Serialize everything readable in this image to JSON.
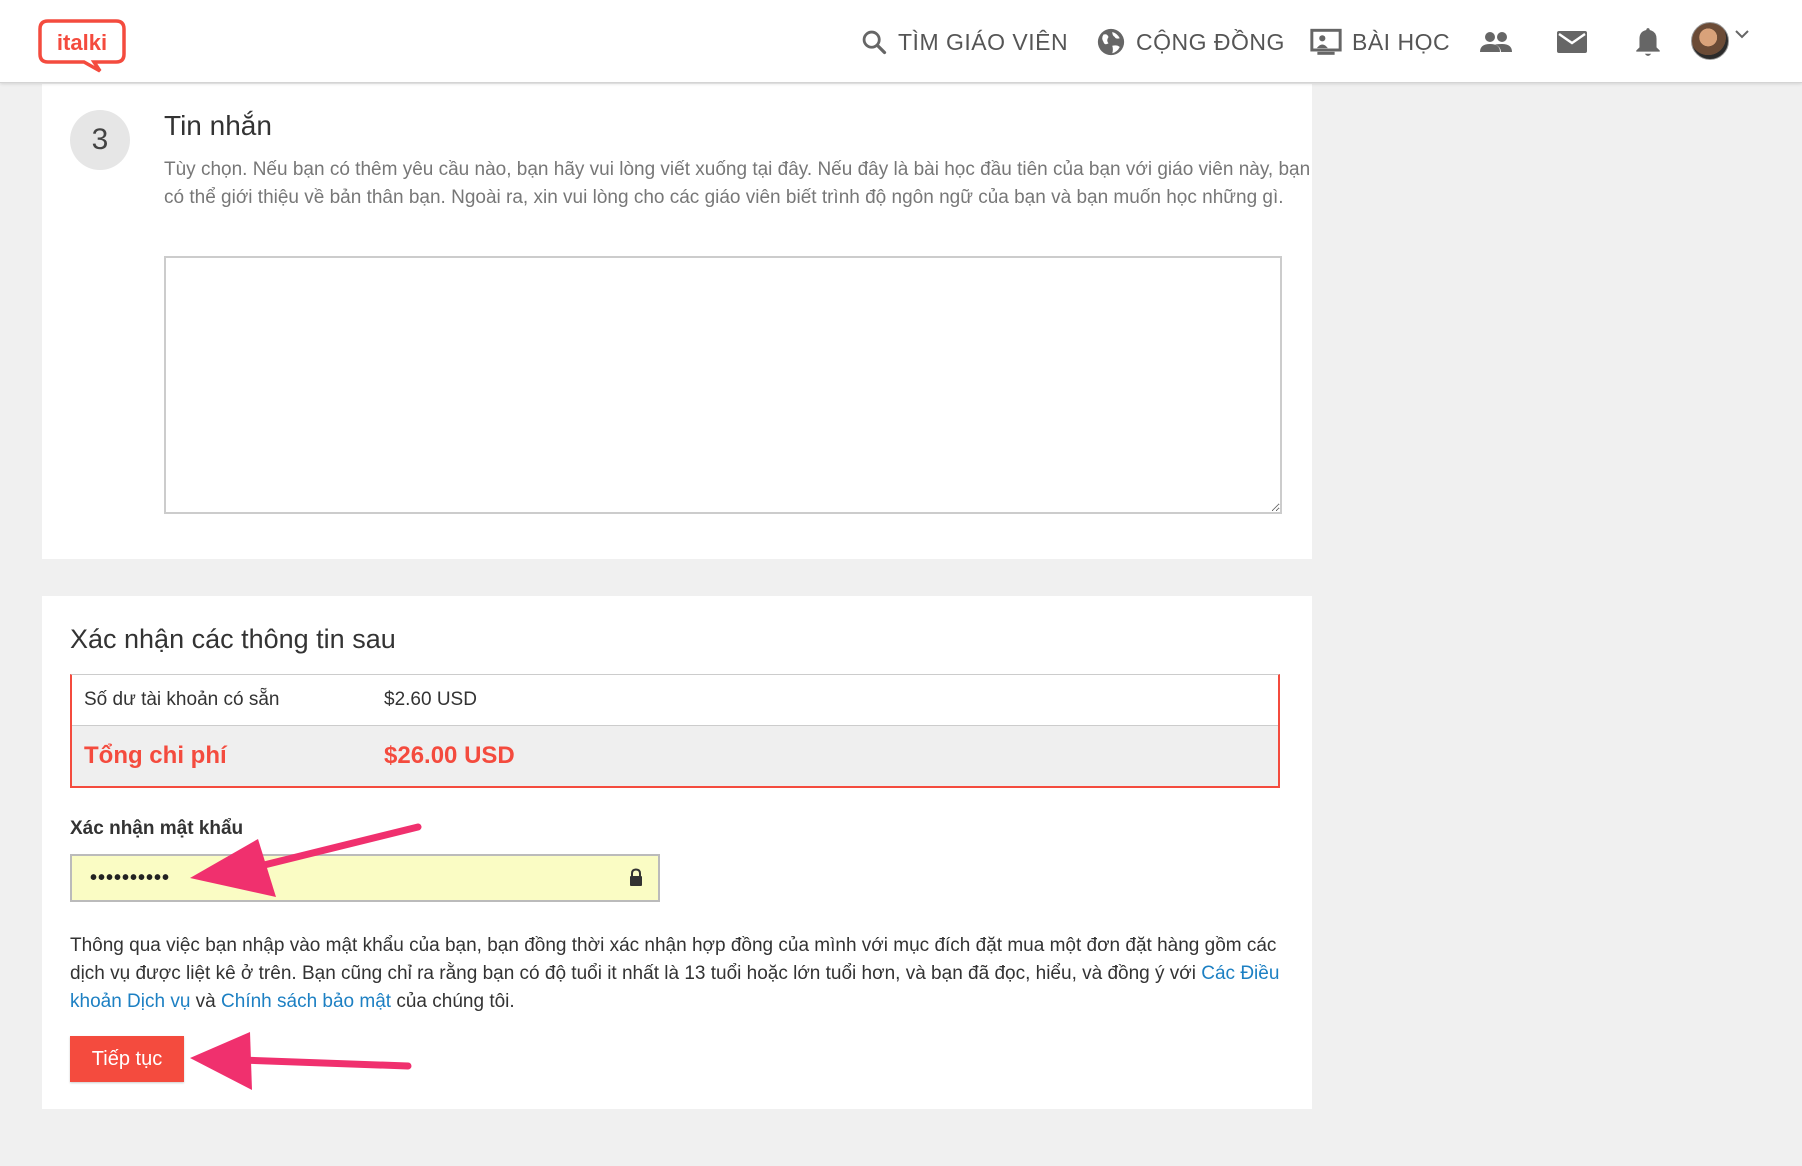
{
  "header": {
    "logo_text": "italki",
    "nav": {
      "find_teacher": "TÌM GIÁO VIÊN",
      "community": "CỘNG ĐỒNG",
      "lessons": "BÀI HỌC"
    },
    "icons": [
      "people-icon",
      "mail-icon",
      "bell-icon",
      "avatar",
      "chevron-down-icon"
    ]
  },
  "message_step": {
    "step_number": "3",
    "title": "Tin nhắn",
    "description": "Tùy chọn. Nếu bạn có thêm yêu cầu nào, bạn hãy vui lòng viết xuống tại đây. Nếu đây là bài học đầu tiên của bạn với giáo viên này, bạn có thể giới thiệu về bản thân bạn. Ngoài ra, xin vui lòng cho các giáo viên biết trình độ ngôn ngữ của bạn và bạn muốn học những gì.",
    "textarea_value": ""
  },
  "confirm": {
    "title": "Xác nhận các thông tin sau",
    "balance_label": "Số dư tài khoản có sẵn",
    "balance_value": "$2.60 USD",
    "total_label": "Tổng chi phí",
    "total_value": "$26.00 USD",
    "password_label": "Xác nhận mật khẩu",
    "password_masked": "••••••••••",
    "terms_text_1": "Thông qua việc bạn nhập vào mật khẩu của bạn, bạn đồng thời xác nhận hợp đồng của mình với mục đích đặt mua một đơn đặt hàng gồm các dịch vụ được liệt kê ở trên. Bạn cũng chỉ ra rằng bạn có độ tuổi it nhất là 13 tuổi hoặc lớn tuổi hơn, và bạn đã đọc, hiểu, và đồng ý với ",
    "terms_link_1": "Các Điều khoản Dịch vụ",
    "terms_text_2": " và ",
    "terms_link_2": "Chính sách bảo mật",
    "terms_text_3": " của chúng tôi.",
    "continue_label": "Tiếp tục"
  },
  "colors": {
    "brand_red": "#f44b3e",
    "link_blue": "#1d80c3",
    "annotation_pink": "#f0306e",
    "password_bg": "#fafcc4"
  }
}
